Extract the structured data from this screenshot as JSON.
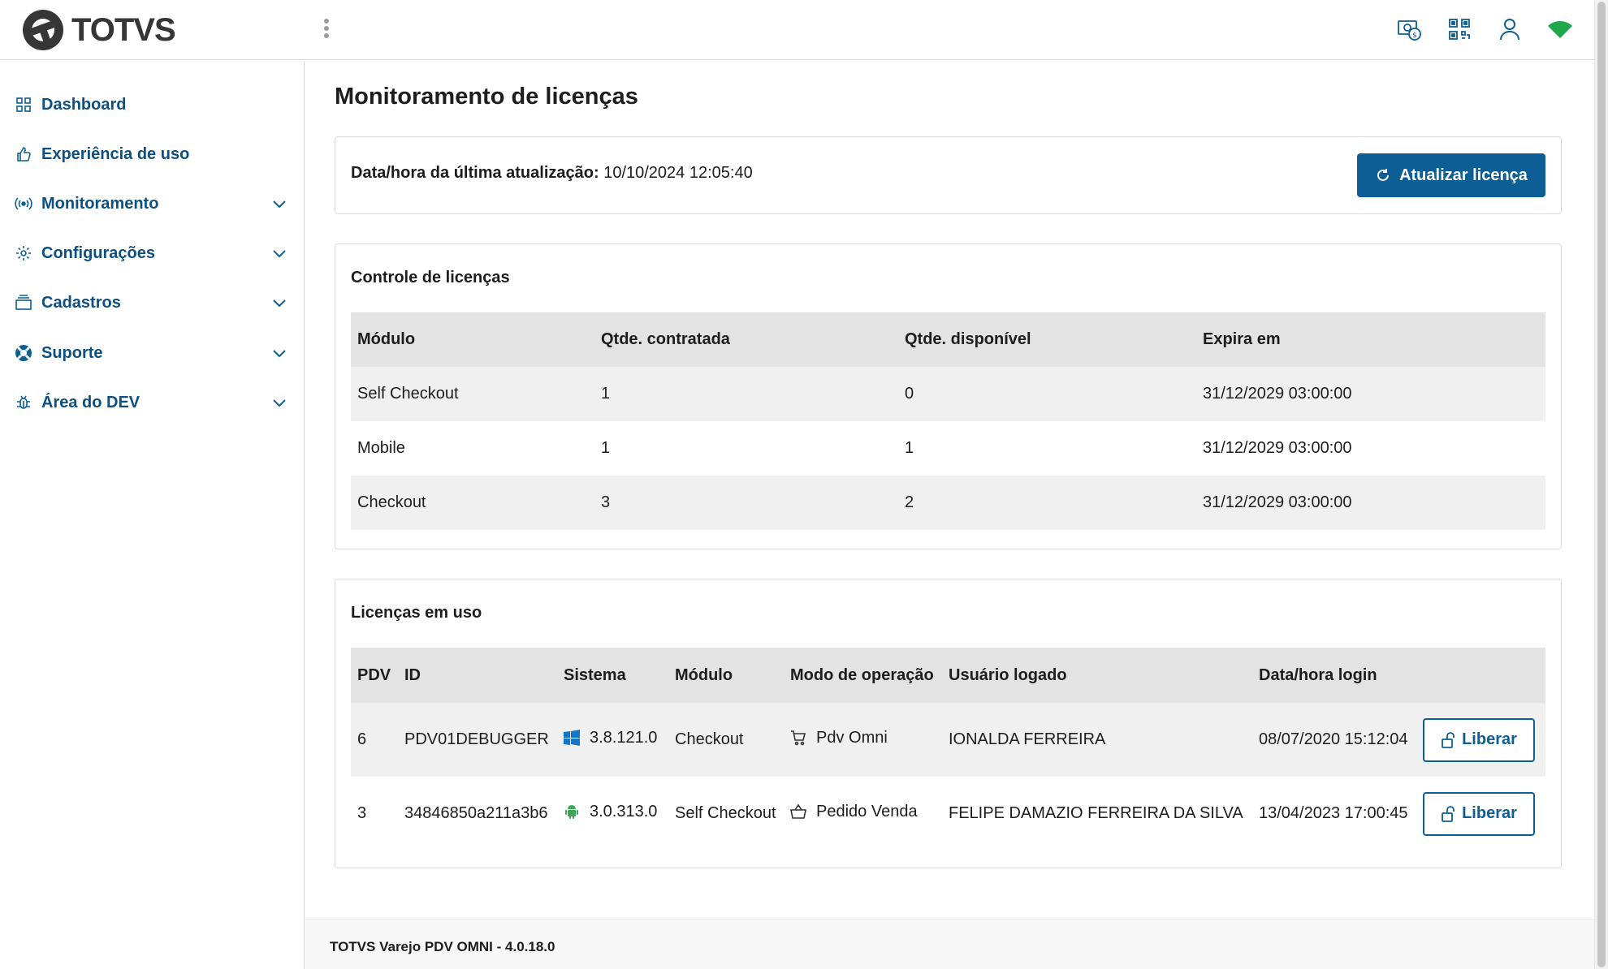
{
  "header": {
    "logo_text": "TOTVS",
    "icons": [
      "cash-register-icon",
      "qr-code-icon",
      "user-icon",
      "wifi-icon"
    ]
  },
  "sidebar": {
    "items": [
      {
        "label": "Dashboard",
        "icon": "dashboard-grid-icon",
        "expandable": false
      },
      {
        "label": "Experiência de uso",
        "icon": "thumbs-up-icon",
        "expandable": false
      },
      {
        "label": "Monitoramento",
        "icon": "broadcast-icon",
        "expandable": true
      },
      {
        "label": "Configurações",
        "icon": "gear-icon",
        "expandable": true
      },
      {
        "label": "Cadastros",
        "icon": "stack-icon",
        "expandable": true
      },
      {
        "label": "Suporte",
        "icon": "lifebuoy-icon",
        "expandable": true
      },
      {
        "label": "Área do DEV",
        "icon": "bug-icon",
        "expandable": true
      }
    ]
  },
  "main": {
    "title": "Monitoramento de licenças",
    "update": {
      "label": "Data/hora da última atualização:",
      "value": "10/10/2024 12:05:40",
      "button_label": "Atualizar licença"
    },
    "control": {
      "title": "Controle de licenças",
      "columns": [
        "Módulo",
        "Qtde. contratada",
        "Qtde. disponível",
        "Expira em"
      ],
      "rows": [
        [
          "Self Checkout",
          "1",
          "0",
          "31/12/2029 03:00:00"
        ],
        [
          "Mobile",
          "1",
          "1",
          "31/12/2029 03:00:00"
        ],
        [
          "Checkout",
          "3",
          "2",
          "31/12/2029 03:00:00"
        ]
      ]
    },
    "in_use": {
      "title": "Licenças em uso",
      "columns": [
        "PDV",
        "ID",
        "Sistema",
        "Módulo",
        "Modo de operação",
        "Usuário logado",
        "Data/hora login",
        ""
      ],
      "rows": [
        {
          "pdv": "6",
          "id": "PDV01DEBUGGER",
          "system_icon": "windows-icon",
          "system": "3.8.121.0",
          "module": "Checkout",
          "mode_icon": "cart-icon",
          "mode": "Pdv Omni",
          "user": "IONALDA FERREIRA",
          "login": "08/07/2020 15:12:04",
          "action": "Liberar"
        },
        {
          "pdv": "3",
          "id": "34846850a211a3b6",
          "system_icon": "android-icon",
          "system": "3.0.313.0",
          "module": "Self Checkout",
          "mode_icon": "basket-icon",
          "mode": "Pedido Venda",
          "user": "FELIPE DAMAZIO FERREIRA DA SILVA",
          "login": "13/04/2023 17:00:45",
          "action": "Liberar"
        }
      ]
    }
  },
  "footer": {
    "text": "TOTVS Varejo PDV OMNI - 4.0.18.0"
  },
  "colors": {
    "primary": "#0c5e94",
    "nav_text": "#0c4f80",
    "header_bg": "#e3e3e3",
    "stripe": "#f0f0f0",
    "wifi": "#1fa84a"
  }
}
